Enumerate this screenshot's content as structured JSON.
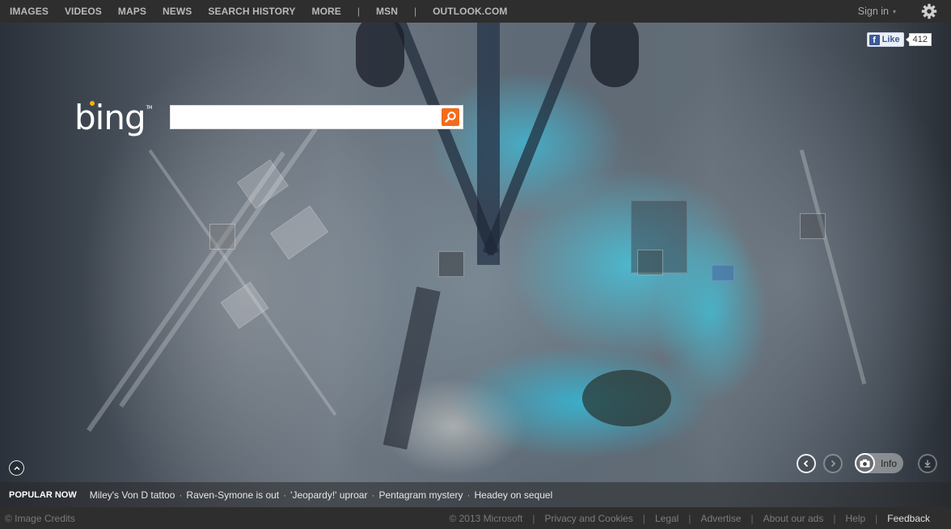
{
  "topbar": {
    "nav": [
      {
        "label": "IMAGES"
      },
      {
        "label": "VIDEOS"
      },
      {
        "label": "MAPS"
      },
      {
        "label": "NEWS"
      },
      {
        "label": "SEARCH HISTORY"
      },
      {
        "label": "MORE"
      }
    ],
    "separator": "|",
    "extra_links": [
      {
        "label": "MSN"
      },
      {
        "label": "OUTLOOK.COM"
      }
    ],
    "signin_label": "Sign in",
    "signin_caret": "▾",
    "settings_icon": "gear-icon"
  },
  "brand": {
    "logo_text": "bing",
    "trademark": "TM",
    "accent_color": "#f7b100"
  },
  "search": {
    "value": "",
    "placeholder": "",
    "button_icon": "magnifier-icon",
    "button_color": "#f26c1b"
  },
  "facebook": {
    "like_label": "Like",
    "f_glyph": "f",
    "count": "412"
  },
  "image_controls": {
    "collapse_icon": "chevron-up-icon",
    "previous_icon": "chevron-left-icon",
    "next_icon": "chevron-right-icon",
    "info_icon": "camera-icon",
    "info_label": "Info",
    "download_icon": "download-icon"
  },
  "hotspots": [
    {
      "name": "hotspot-1"
    },
    {
      "name": "hotspot-2"
    },
    {
      "name": "hotspot-3"
    },
    {
      "name": "hotspot-4"
    }
  ],
  "popular_now": {
    "title": "POPULAR NOW",
    "separator": "·",
    "items": [
      {
        "label": "Miley's Von D tattoo"
      },
      {
        "label": "Raven-Symone is out"
      },
      {
        "label": "'Jeopardy!' uproar"
      },
      {
        "label": "Pentagram mystery"
      },
      {
        "label": "Headey on sequel"
      }
    ]
  },
  "footer": {
    "image_credits": "© Image Credits",
    "copyright": "© 2013 Microsoft",
    "separator": "|",
    "links": [
      {
        "label": "Privacy and Cookies"
      },
      {
        "label": "Legal"
      },
      {
        "label": "Advertise"
      },
      {
        "label": "About our ads"
      },
      {
        "label": "Help"
      },
      {
        "label": "Feedback"
      }
    ]
  }
}
